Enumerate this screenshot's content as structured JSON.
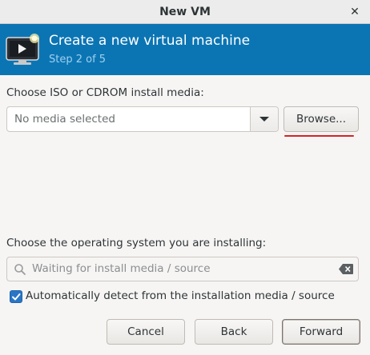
{
  "window": {
    "title": "New VM",
    "close_glyph": "✕"
  },
  "banner": {
    "heading": "Create a new virtual machine",
    "step": "Step 2 of 5",
    "icon": "vm-monitor-icon"
  },
  "install_media": {
    "label": "Choose ISO or CDROM install media:",
    "combo_value": "No media selected",
    "browse_label": "Browse..."
  },
  "os_select": {
    "label": "Choose the operating system you are installing:",
    "placeholder": "Waiting for install media / source"
  },
  "auto_detect": {
    "checked": true,
    "label": "Automatically detect from the installation media / source"
  },
  "footer": {
    "cancel_label": "Cancel",
    "back_label": "Back",
    "forward_label": "Forward"
  },
  "colors": {
    "banner": "#0b75b4",
    "step_text": "#9fd0ee",
    "checkbox": "#2a76c6",
    "highlight": "#d42525"
  }
}
